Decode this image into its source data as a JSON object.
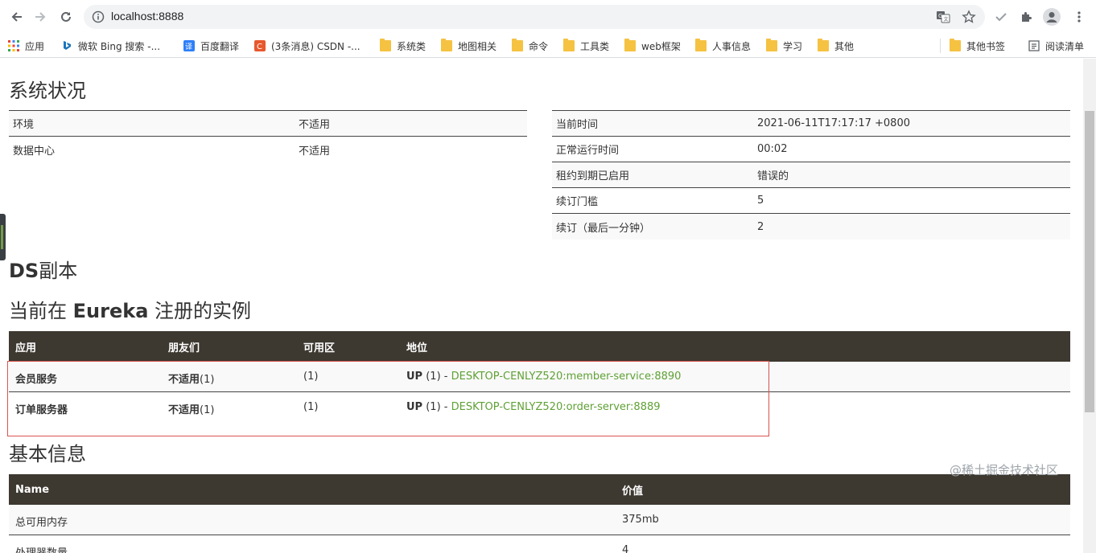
{
  "browser": {
    "url": "localhost:8888",
    "bookmarks": [
      {
        "label": "应用",
        "icon": "apps-grid-icon"
      },
      {
        "label": "微软 Bing 搜索 -...",
        "icon": "bing-icon"
      },
      {
        "label": "百度翻译",
        "icon": "baidu-translate-icon"
      },
      {
        "label": "(3条消息) CSDN -...",
        "icon": "csdn-icon"
      },
      {
        "label": "系统类",
        "icon": "folder-icon"
      },
      {
        "label": "地图相关",
        "icon": "folder-icon"
      },
      {
        "label": "命令",
        "icon": "folder-icon"
      },
      {
        "label": "工具类",
        "icon": "folder-icon"
      },
      {
        "label": "web框架",
        "icon": "folder-icon"
      },
      {
        "label": "人事信息",
        "icon": "folder-icon"
      },
      {
        "label": "学习",
        "icon": "folder-icon"
      },
      {
        "label": "其他",
        "icon": "folder-icon"
      }
    ],
    "other_bookmarks": "其他书签",
    "reading_list": "阅读清单"
  },
  "system_status": {
    "title": "系统状况",
    "left": [
      {
        "key": "环境",
        "value": "不适用"
      },
      {
        "key": "数据中心",
        "value": "不适用"
      }
    ],
    "right": [
      {
        "key": "当前时间",
        "value": "2021-06-11T17:17:17 +0800"
      },
      {
        "key": "正常运行时间",
        "value": "00:02"
      },
      {
        "key": "租约到期已启用",
        "value": "错误的"
      },
      {
        "key": "续订门槛",
        "value": "5"
      },
      {
        "key": "续订（最后一分钟）",
        "value": "2"
      }
    ]
  },
  "replicas": {
    "title_bold": "DS",
    "title_rest": "副本"
  },
  "instances": {
    "title_pre": "当前在 ",
    "title_bold": "Eureka",
    "title_post": " 注册的实例",
    "headers": [
      "应用",
      "朋友们",
      "可用区",
      "地位"
    ],
    "rows": [
      {
        "app": "会员服务",
        "ami_bold": "不适用",
        "ami_count": "(1)",
        "zones": "(1)",
        "status_bold": "UP",
        "status_mid": " (1) - ",
        "link": "DESKTOP-CENLYZ520:member-service:8890"
      },
      {
        "app": "订单服务器",
        "ami_bold": "不适用",
        "ami_count": "(1)",
        "zones": "(1)",
        "status_bold": "UP",
        "status_mid": " (1) - ",
        "link": "DESKTOP-CENLYZ520:order-server:8889"
      }
    ]
  },
  "general_info": {
    "title": "基本信息",
    "headers": [
      "Name",
      "价值"
    ],
    "rows": [
      {
        "name": "总可用内存",
        "value": "375mb"
      },
      {
        "name": "处理器数量",
        "value": "4"
      }
    ]
  },
  "watermark": "@稀土掘金技术社区",
  "colors": {
    "table_header": "#3d3830",
    "link": "#5fa134",
    "highlight_box": "#d9534f"
  }
}
